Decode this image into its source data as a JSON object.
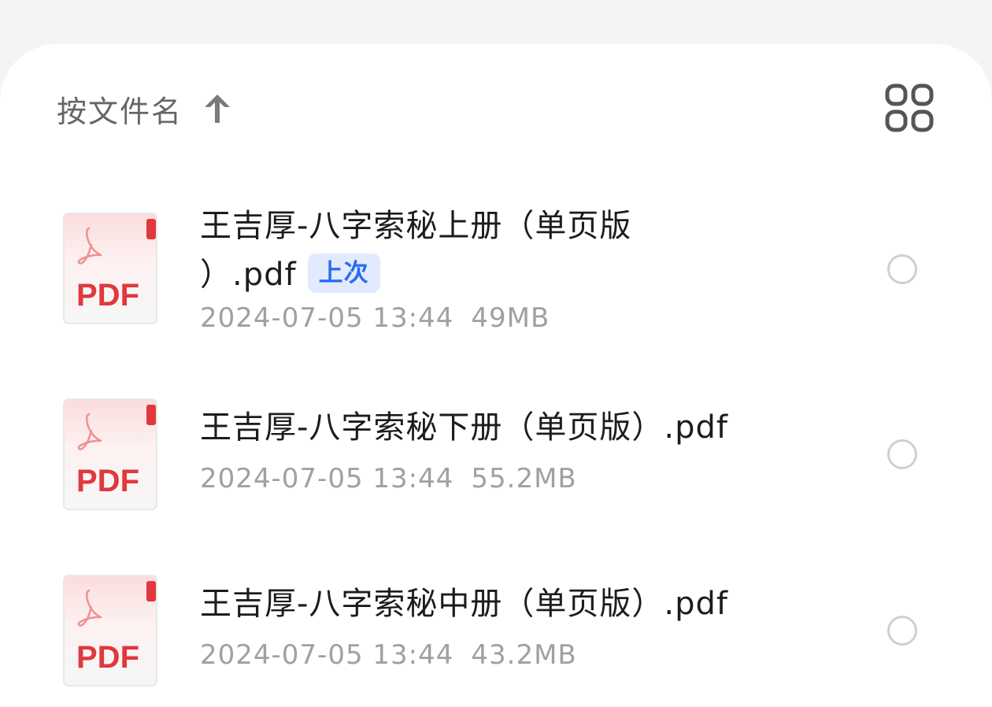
{
  "toolbar": {
    "sort_label": "按文件名",
    "sort_direction_icon": "arrow-up-icon",
    "view_toggle_icon": "grid-view-icon"
  },
  "files": [
    {
      "name": "王吉厚-八字索秘上册（单页版）.pdf",
      "name_line1": "王吉厚-八字索秘上册（单页版",
      "name_line2": "）.pdf",
      "badge": "上次",
      "date": "2024-07-05 13:44",
      "size": "49MB",
      "type_label": "PDF",
      "selected": false
    },
    {
      "name": "王吉厚-八字索秘下册（单页版）.pdf",
      "date": "2024-07-05 13:44",
      "size": "55.2MB",
      "type_label": "PDF",
      "selected": false
    },
    {
      "name": "王吉厚-八字索秘中册（单页版）.pdf",
      "date": "2024-07-05 13:44",
      "size": "43.2MB",
      "type_label": "PDF",
      "selected": false
    }
  ],
  "colors": {
    "pdf_red": "#e0383e",
    "badge_bg": "#e1ebfd",
    "badge_text": "#2b6bf3",
    "meta_text": "#a0a0a0",
    "sheet_bg": "#ffffff",
    "page_bg": "#f4f4f6"
  }
}
